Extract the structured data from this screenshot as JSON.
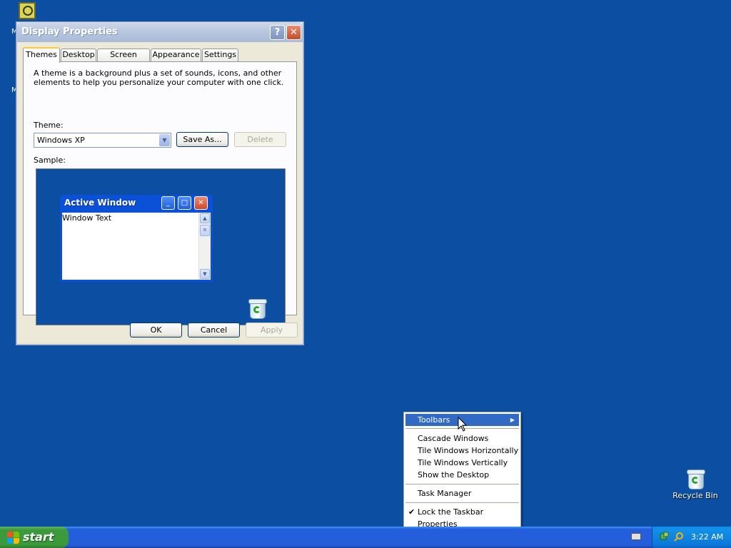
{
  "desktop": {
    "recycle_label": "Recycle Bin",
    "edge_text_1": "M",
    "edge_text_2": "M"
  },
  "dialog": {
    "title": "Display Properties",
    "tabs": [
      {
        "label": "Themes"
      },
      {
        "label": "Desktop"
      },
      {
        "label": "Screen Saver"
      },
      {
        "label": "Appearance"
      },
      {
        "label": "Settings"
      }
    ],
    "description": "A theme is a background plus a set of sounds, icons, and other elements to help you personalize your computer with one click.",
    "theme_label": "Theme:",
    "theme_value": "Windows XP",
    "save_as_label": "Save As...",
    "delete_label": "Delete",
    "sample_label": "Sample:",
    "sample": {
      "window_title": "Active Window",
      "window_text": "Window Text"
    },
    "ok_label": "OK",
    "cancel_label": "Cancel",
    "apply_label": "Apply"
  },
  "context_menu": {
    "items": [
      {
        "label": "Toolbars"
      },
      {
        "label": "Cascade Windows"
      },
      {
        "label": "Tile Windows Horizontally"
      },
      {
        "label": "Tile Windows Vertically"
      },
      {
        "label": "Show the Desktop"
      },
      {
        "label": "Task Manager"
      },
      {
        "label": "Lock the Taskbar",
        "checked": true
      },
      {
        "label": "Properties"
      }
    ]
  },
  "taskbar": {
    "start_label": "start",
    "clock": "3:22 AM"
  },
  "colors": {
    "desktop_bg": "#0b4ea2",
    "menu_highlight": "#316ac5",
    "taskbar": "#245edb",
    "start_button": "#3c9a3c"
  }
}
